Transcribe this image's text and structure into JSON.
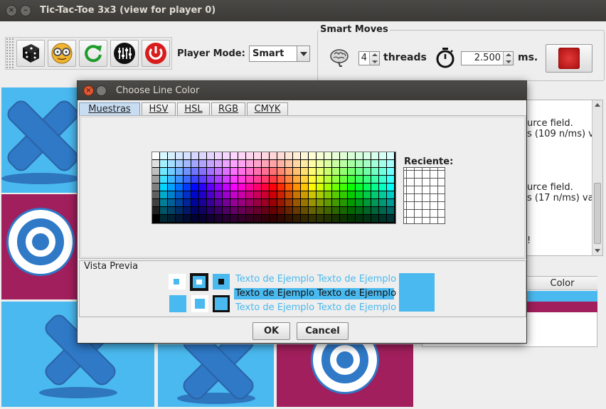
{
  "window": {
    "title": "Tic-Tac-Toe 3x3 (view for player 0)"
  },
  "toolbar": {
    "buttons": [
      "dice-icon",
      "goggles-icon",
      "refresh-icon",
      "sliders-icon",
      "power-icon"
    ]
  },
  "player_mode": {
    "label": "Player Mode:",
    "value": "Smart"
  },
  "smart_moves": {
    "legend": "Smart Moves",
    "threads_value": "4",
    "threads_label": "threads",
    "time_value": "2.500",
    "time_unit": "ms."
  },
  "board": {
    "cells": [
      "X",
      "",
      "",
      "O",
      "",
      "",
      "X",
      "X",
      "O"
    ],
    "colors": {
      "blue": "#4ab9ef",
      "magenta": "#a11f5c",
      "mark": "#2f79c7"
    }
  },
  "log": {
    "lines": [
      "urce field.",
      "s (109 n/ms) v",
      "urce field.",
      "s (17 n/ms) val",
      "!"
    ]
  },
  "color_table": {
    "header": "Color"
  },
  "dialog": {
    "title": "Choose Line Color",
    "tabs": [
      "Muestras",
      "HSV",
      "HSL",
      "RGB",
      "CMYK"
    ],
    "active_tab": "Muestras",
    "recent_label": "Reciente:",
    "preview_legend": "Vista Previa",
    "sample_text": "Texto de Ejemplo",
    "ok_label": "OK",
    "cancel_label": "Cancel",
    "selected_color": "#4ab9ef"
  }
}
